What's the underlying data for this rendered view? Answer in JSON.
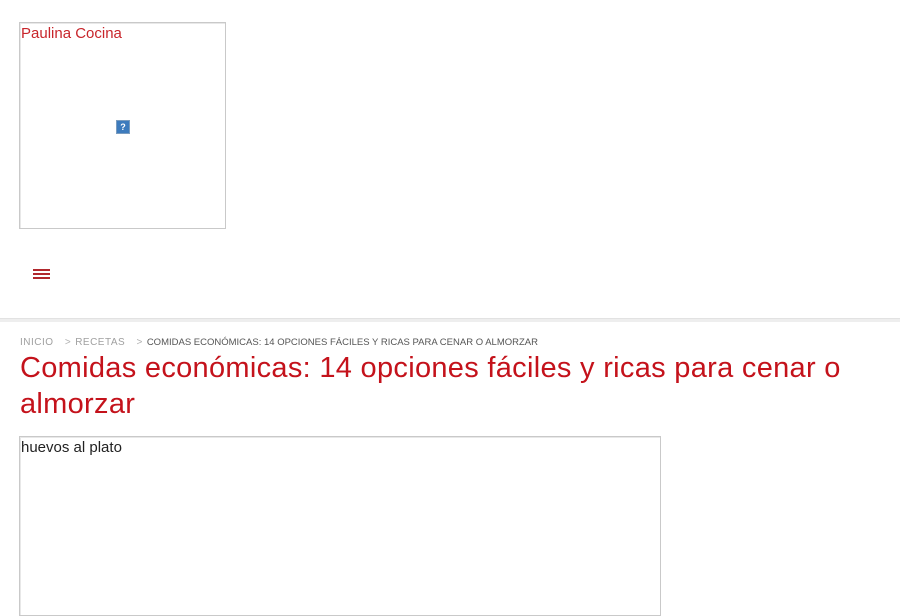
{
  "header": {
    "logo_alt": "Paulina Cocina",
    "broken_image_glyph": "?",
    "menu_icon": "hamburger-menu-icon"
  },
  "breadcrumb": {
    "items": [
      {
        "label": "Inicio"
      },
      {
        "label": "Recetas"
      }
    ],
    "separator": ">",
    "current": "Comidas económicas: 14 opciones fáciles y ricas para cenar o almorzar"
  },
  "article": {
    "title": "Comidas económicas: 14 opciones fáciles y ricas para cenar o almorzar",
    "hero_image_alt": "huevos al plato"
  },
  "colors": {
    "accent": "#c4121b",
    "menu_icon": "#b0282d"
  }
}
